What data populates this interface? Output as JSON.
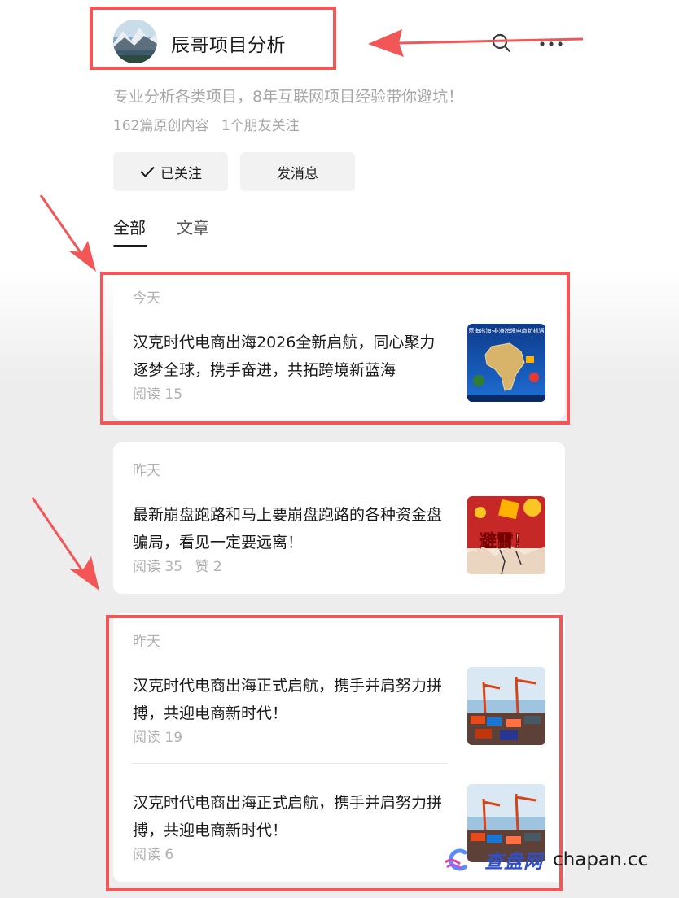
{
  "profile": {
    "name": "辰哥项目分析",
    "bio": "专业分析各类项目，8年互联网项目经验带你避坑！",
    "stats": {
      "articles": "162篇原创内容",
      "friends": "1个朋友关注"
    }
  },
  "actions": {
    "follow_label": "已关注",
    "message_label": "发消息"
  },
  "tabs": [
    {
      "label": "全部",
      "active": true
    },
    {
      "label": "文章",
      "active": false
    }
  ],
  "groups": [
    {
      "date": "今天",
      "articles": [
        {
          "title": "汉克时代电商出海2026全新启航，同心聚力逐梦全球，携手奋进，共拓跨境新蓝海",
          "read": "阅读 15",
          "thumb_caption": "蓝海出海·非洲跨境电商新机遇"
        }
      ]
    },
    {
      "date": "昨天",
      "articles": [
        {
          "title": "最新崩盘跑路和马上要崩盘跑路的各种资金盘骗局，看见一定要远离！",
          "read": "阅读 35",
          "likes": "赞 2",
          "thumb_caption": "避雷！"
        }
      ]
    },
    {
      "date": "昨天",
      "articles": [
        {
          "title": "汉克时代电商出海正式启航，携手并肩努力拼搏，共迎电商新时代！",
          "read": "阅读 19"
        },
        {
          "title": "汉克时代电商出海正式启航，携手并肩努力拼搏，共迎电商新时代！",
          "read": "阅读 6"
        }
      ]
    }
  ],
  "watermark": {
    "cn": "查盘网",
    "en": "chapan.cc"
  },
  "icons": [
    "search-icon",
    "more-icon",
    "check-icon"
  ],
  "colors": {
    "annotation": "#f25656",
    "watermark_blue": "#2f50c8"
  }
}
